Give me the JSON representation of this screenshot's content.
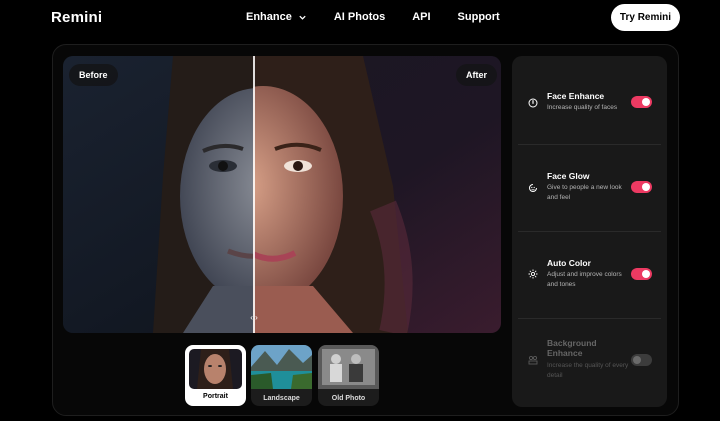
{
  "nav": {
    "logo": "Remini",
    "links": [
      {
        "label": "Enhance",
        "has_dropdown": true
      },
      {
        "label": "AI Photos"
      },
      {
        "label": "API"
      },
      {
        "label": "Support"
      }
    ],
    "cta": "Try Remini"
  },
  "preview": {
    "before_label": "Before",
    "after_label": "After",
    "handle": "‹ ›"
  },
  "thumbnails": [
    {
      "label": "Portrait",
      "selected": true
    },
    {
      "label": "Landscape",
      "selected": false
    },
    {
      "label": "Old Photo",
      "selected": false
    }
  ],
  "features": [
    {
      "title": "Face Enhance",
      "description": "Increase quality of faces",
      "icon": "face-enhance-icon",
      "enabled": true
    },
    {
      "title": "Face Glow",
      "description": "Give to people a new look and feel",
      "icon": "face-glow-icon",
      "enabled": true
    },
    {
      "title": "Auto Color",
      "description": "Adjust and improve colors and tones",
      "icon": "auto-color-icon",
      "enabled": true
    },
    {
      "title": "Background Enhance",
      "description": "Increase the quality of every detail",
      "icon": "background-enhance-icon",
      "enabled": false
    }
  ],
  "colors": {
    "accent": "#ec3a62",
    "panel": "#191919",
    "background": "#000000"
  }
}
